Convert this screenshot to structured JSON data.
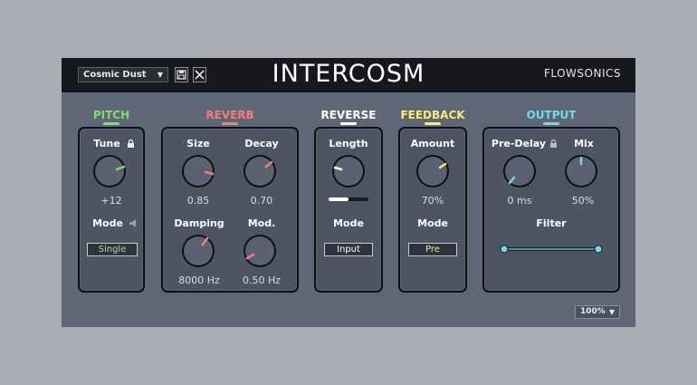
{
  "header": {
    "preset": "Cosmic Dust",
    "title": "INTERCOSM",
    "brand": "FLOWSONICS",
    "save_icon": "save-icon",
    "close_icon": "close-icon"
  },
  "colors": {
    "pitch": "#7fdc7a",
    "reverb": "#f07f7a",
    "reverse": "#ffffff",
    "feedback": "#f5ea7a",
    "output": "#76d8e8"
  },
  "pitch": {
    "title": "PITCH",
    "tune_label": "Tune",
    "tune_value": "+12",
    "mode_label": "Mode",
    "mode_value": "Single",
    "lock_icon": "lock-icon",
    "speaker_icon": "speaker-icon"
  },
  "reverb": {
    "title": "REVERB",
    "size_label": "Size",
    "size_value": "0.85",
    "decay_label": "Decay",
    "decay_value": "0.70",
    "damping_label": "Damping",
    "damping_value": "8000 Hz",
    "mod_label": "Mod.",
    "mod_value": "0.50 Hz"
  },
  "reverse": {
    "title": "REVERSE",
    "length_label": "Length",
    "length_fraction": 0.5,
    "mode_label": "Mode",
    "mode_value": "Input"
  },
  "feedback": {
    "title": "FEEDBACK",
    "amount_label": "Amount",
    "amount_value": "70%",
    "mode_label": "Mode",
    "mode_value": "Pre"
  },
  "output": {
    "title": "OUTPUT",
    "predelay_label": "Pre-Delay",
    "predelay_value": "0 ms",
    "mix_label": "Mix",
    "mix_value": "50%",
    "filter_label": "Filter",
    "lock_icon": "lock-icon"
  },
  "footer": {
    "zoom": "100%"
  }
}
